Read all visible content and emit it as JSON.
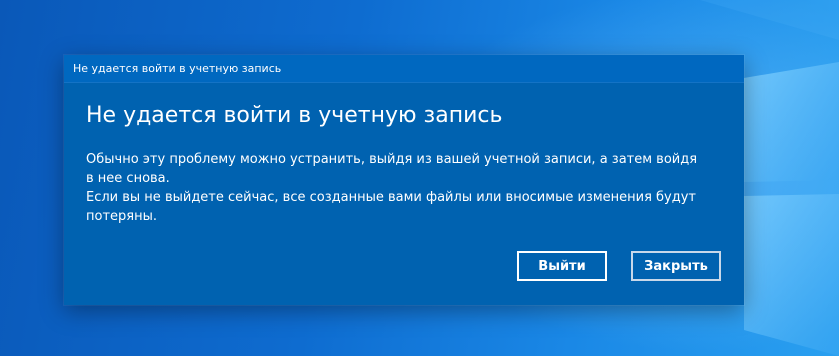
{
  "dialog": {
    "window_title": "Не удается войти в учетную запись",
    "heading": "Не удается войти в учетную запись",
    "message_line1": "Обычно эту проблему можно устранить, выйдя из вашей учетной записи, а затем войдя в нее снова.",
    "message_line2": "Если вы не выйдете сейчас, все созданные вами файлы или вносимые изменения будут потеряны.",
    "buttons": {
      "sign_out_label": "Выйти",
      "close_label": "Закрыть"
    }
  },
  "colors": {
    "dialog_background": "#0062b0",
    "titlebar_background": "#0068c0",
    "desktop_background": "#0e6cd0",
    "text": "#ffffff"
  },
  "desktop": {
    "wallpaper_icon": "windows-logo-icon"
  }
}
